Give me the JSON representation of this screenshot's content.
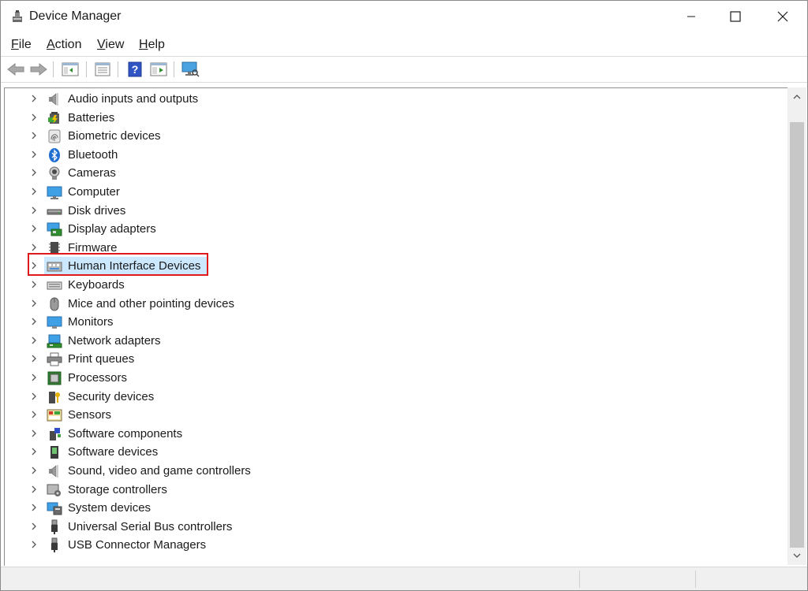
{
  "window": {
    "title": "Device Manager"
  },
  "menu": [
    {
      "label": "File",
      "accel": "F",
      "rest": "ile"
    },
    {
      "label": "Action",
      "accel": "A",
      "rest": "ction"
    },
    {
      "label": "View",
      "accel": "V",
      "rest": "iew"
    },
    {
      "label": "Help",
      "accel": "H",
      "rest": "elp"
    }
  ],
  "toolbar": [
    "back-arrow-icon",
    "forward-arrow-icon",
    "show-hide-console-tree-icon",
    "properties-icon",
    "help-icon",
    "run-icon",
    "scan-hardware-icon"
  ],
  "tree": {
    "items": [
      {
        "label": "Audio inputs and outputs",
        "icon": "speaker-icon"
      },
      {
        "label": "Batteries",
        "icon": "battery-icon"
      },
      {
        "label": "Biometric devices",
        "icon": "fingerprint-icon"
      },
      {
        "label": "Bluetooth",
        "icon": "bluetooth-icon"
      },
      {
        "label": "Cameras",
        "icon": "camera-icon"
      },
      {
        "label": "Computer",
        "icon": "computer-icon"
      },
      {
        "label": "Disk drives",
        "icon": "disk-drive-icon"
      },
      {
        "label": "Display adapters",
        "icon": "display-adapter-icon"
      },
      {
        "label": "Firmware",
        "icon": "firmware-icon"
      },
      {
        "label": "Human Interface Devices",
        "icon": "hid-icon",
        "selected": true
      },
      {
        "label": "Keyboards",
        "icon": "keyboard-icon"
      },
      {
        "label": "Mice and other pointing devices",
        "icon": "mouse-icon"
      },
      {
        "label": "Monitors",
        "icon": "monitor-icon"
      },
      {
        "label": "Network adapters",
        "icon": "network-adapter-icon"
      },
      {
        "label": "Print queues",
        "icon": "printer-icon"
      },
      {
        "label": "Processors",
        "icon": "processor-icon"
      },
      {
        "label": "Security devices",
        "icon": "security-device-icon"
      },
      {
        "label": "Sensors",
        "icon": "sensor-icon"
      },
      {
        "label": "Software components",
        "icon": "software-component-icon"
      },
      {
        "label": "Software devices",
        "icon": "software-device-icon"
      },
      {
        "label": "Sound, video and game controllers",
        "icon": "sound-controller-icon"
      },
      {
        "label": "Storage controllers",
        "icon": "storage-controller-icon"
      },
      {
        "label": "System devices",
        "icon": "system-devices-icon"
      },
      {
        "label": "Universal Serial Bus controllers",
        "icon": "usb-icon"
      },
      {
        "label": "USB Connector Managers",
        "icon": "usb-connector-icon"
      }
    ]
  },
  "colors": {
    "selection": "#cce8ff",
    "highlight_box": "#e0191b"
  }
}
